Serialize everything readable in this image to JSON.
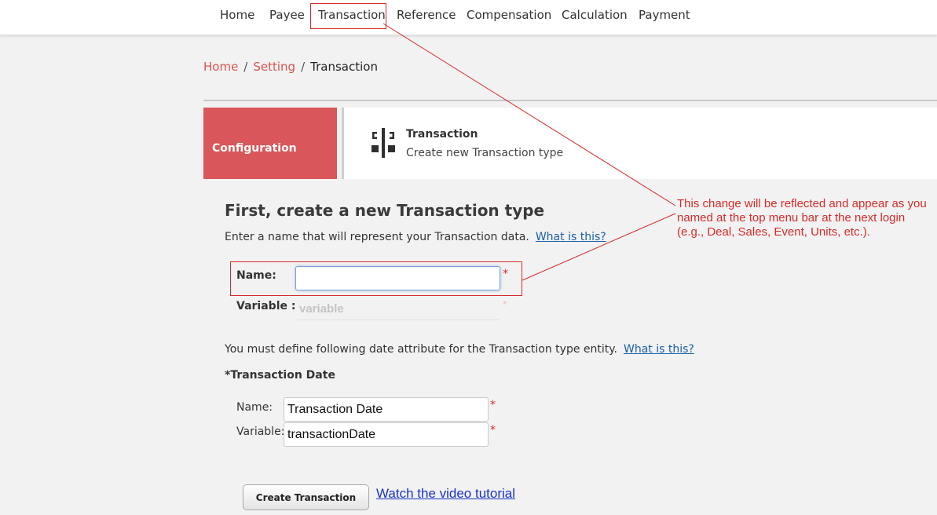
{
  "top_nav": {
    "items": [
      "Home",
      "Payee",
      "Transaction",
      "Reference",
      "Compensation",
      "Calculation",
      "Payment"
    ]
  },
  "breadcrumb": {
    "home": "Home",
    "setting": "Setting",
    "separator": "/",
    "current": "Transaction"
  },
  "config_tile": {
    "label": "Configuration"
  },
  "info_panel": {
    "icon": "transaction-type-icon",
    "title": "Transaction",
    "subtitle": "Create new Transaction type"
  },
  "form": {
    "heading": "First, create a new Transaction type",
    "description": "Enter a name that will represent your Transaction data.",
    "help_link": "What is this?",
    "name_label": "Name:",
    "name_value": "",
    "variable_label": "Variable :",
    "variable_placeholder": "variable",
    "required_mark": "*"
  },
  "date_attribute": {
    "description": "You must define following date attribute for the Transaction type entity.",
    "help_link": "What is this?",
    "title": "*Transaction Date",
    "name_label": "Name:",
    "name_value": "Transaction Date",
    "variable_label": "Variable:",
    "variable_value": "transactionDate"
  },
  "actions": {
    "create_button": "Create Transaction",
    "video_link": "Watch the video tutorial"
  },
  "annotation": {
    "text": "This change will be reflected and appear as you named at the top menu bar at the next login (e.g., Deal, Sales, Event, Units, etc.).",
    "color": "#d62b2b"
  },
  "colors": {
    "accent": "#d9575a",
    "link": "#1a5fa8"
  }
}
